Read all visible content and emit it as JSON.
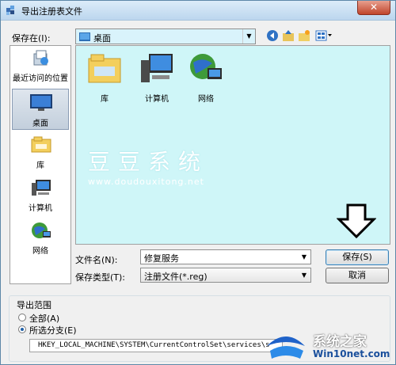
{
  "window": {
    "title": "导出注册表文件",
    "close_glyph": "✕"
  },
  "toolbar": {
    "save_in_label": "保存在(I):",
    "save_in_value": "桌面"
  },
  "places": [
    {
      "label": "最近访问的位置",
      "icon": "recent-places-icon"
    },
    {
      "label": "桌面",
      "icon": "desktop-icon",
      "selected": true
    },
    {
      "label": "库",
      "icon": "libraries-icon"
    },
    {
      "label": "计算机",
      "icon": "computer-icon"
    },
    {
      "label": "网络",
      "icon": "network-icon"
    }
  ],
  "files": [
    {
      "label": "库",
      "icon": "libraries-icon"
    },
    {
      "label": "计算机",
      "icon": "computer-icon"
    },
    {
      "label": "网络",
      "icon": "network-icon"
    }
  ],
  "watermark": {
    "text": "豆豆系统",
    "url": "www.doudouxitong.net"
  },
  "form": {
    "filename_label": "文件名(N):",
    "filename_value": "修复服务",
    "filetype_label": "保存类型(T):",
    "filetype_value": "注册文件(*.reg)",
    "save_button": "保存(S)",
    "cancel_button": "取消"
  },
  "export_range": {
    "title": "导出范围",
    "all_label": "全部(A)",
    "branch_label": "所选分支(E)",
    "selected": "branch",
    "branch_path": "HKEY_LOCAL_MACHINE\\SYSTEM\\CurrentControlSet\\services\\s"
  },
  "brand": {
    "name": "系统之家",
    "site": "Win10net.com"
  }
}
